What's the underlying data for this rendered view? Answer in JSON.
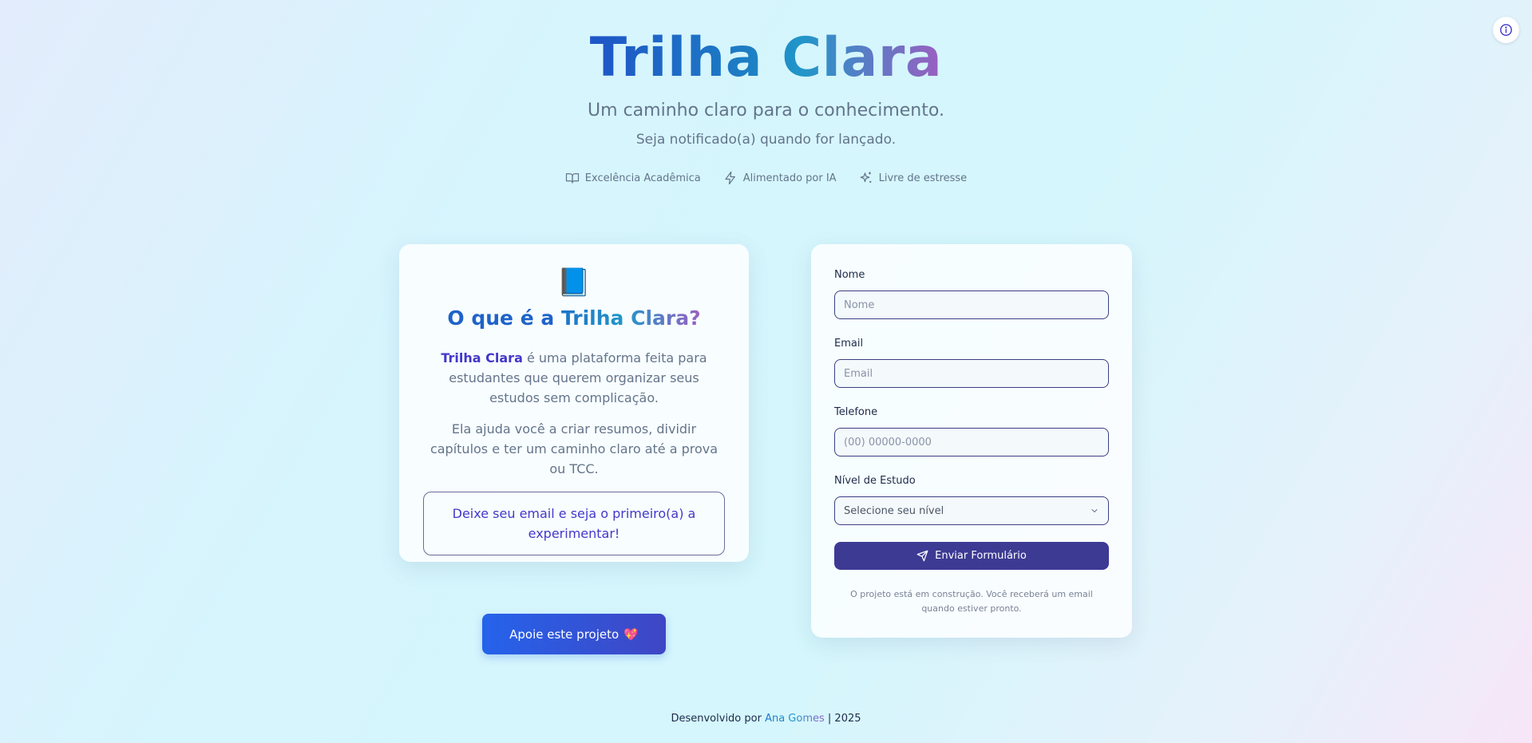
{
  "hero": {
    "title": "Trilha Clara",
    "subtitle": "Um caminho claro para o conhecimento.",
    "notify": "Seja notificado(a) quando for lançado."
  },
  "features": [
    {
      "icon": "book-open-icon",
      "label": "Excelência Acadêmica"
    },
    {
      "icon": "lightning-icon",
      "label": "Alimentado por IA"
    },
    {
      "icon": "sparkles-icon",
      "label": "Livre de estresse"
    }
  ],
  "about": {
    "emoji": "📘",
    "title_plain": "O que é a ",
    "title_highlight": "Trilha Clara?",
    "p1_strong": "Trilha Clara",
    "p1_rest": " é uma plataforma feita para estudantes que querem organizar seus estudos sem complicação.",
    "p2": "Ela ajuda você a criar resumos, dividir capítulos e ter um caminho claro até a prova ou TCC.",
    "cta": "Deixe seu email e seja o primeiro(a) a experimentar!"
  },
  "support": {
    "label": "Apoie este projeto",
    "emoji": "💖"
  },
  "form": {
    "name": {
      "label": "Nome",
      "placeholder": "Nome",
      "value": ""
    },
    "email": {
      "label": "Email",
      "placeholder": "Email",
      "value": ""
    },
    "phone": {
      "label": "Telefone",
      "placeholder": "(00) 00000-0000",
      "value": ""
    },
    "level": {
      "label": "Nível de Estudo",
      "selected": "Selecione seu nível"
    },
    "submit_label": "Enviar Formulário",
    "note": "O projeto está em construção. Você receberá um email quando estiver pronto."
  },
  "footer": {
    "prefix": "Desenvolvido por ",
    "author": "Ana Gomes",
    "suffix": " | 2025"
  },
  "colors": {
    "primary": "#3d3a94",
    "accent_blue": "#2563eb",
    "title_gradient_start": "#1e55c7",
    "title_gradient_end": "#9b5fc0"
  }
}
